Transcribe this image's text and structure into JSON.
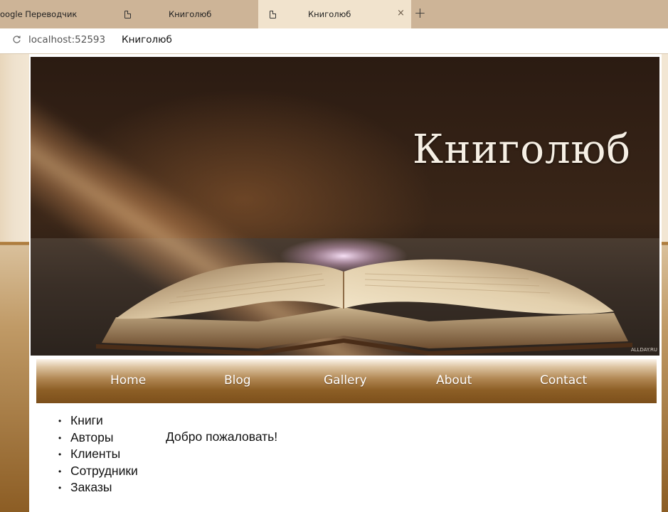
{
  "browser": {
    "tabs": [
      {
        "label": "oogle Переводчик",
        "active": false
      },
      {
        "label": "Книголюб",
        "active": false
      },
      {
        "label": "Книголюб",
        "active": true
      }
    ],
    "close_icon": "×",
    "new_tab_icon": "+",
    "reload_icon": "reload-icon",
    "url_host": "localhost:52593",
    "url_title": "Книголюб"
  },
  "banner": {
    "title": "Книголюб",
    "watermark": "ALLDAY.RU"
  },
  "nav": {
    "items": [
      "Home",
      "Blog",
      "Gallery",
      "About",
      "Contact"
    ]
  },
  "sidebar": {
    "items": [
      "Книги",
      "Авторы",
      "Клиенты",
      "Сотрудники",
      "Заказы"
    ]
  },
  "main": {
    "welcome": "Добро пожаловать!"
  },
  "colors": {
    "tabbar": "#cdb497",
    "nav_dark": "#7c4f1b",
    "nav_light": "#dcc3a0",
    "page_accent": "#a77536"
  }
}
